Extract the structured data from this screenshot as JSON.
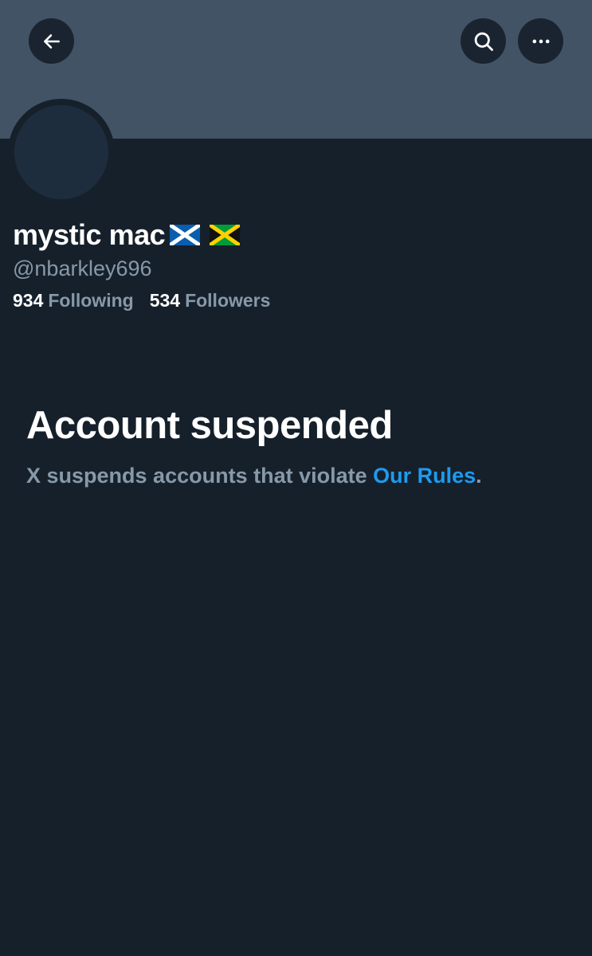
{
  "header": {
    "back_icon": "arrow-left-icon",
    "search_icon": "search-icon",
    "more_icon": "more-horizontal-icon"
  },
  "profile": {
    "display_name": "mystic mac",
    "flags": [
      "scotland-flag",
      "jamaica-flag"
    ],
    "handle": "@nbarkley696",
    "following_count": "934",
    "following_label": "Following",
    "followers_count": "534",
    "followers_label": "Followers"
  },
  "notice": {
    "title": "Account suspended",
    "message": "X suspends accounts that violate ",
    "link_text": "Our Rules",
    "message_end": "."
  },
  "colors": {
    "background": "#16202b",
    "banner": "#425365",
    "link": "#1d9bf0",
    "secondary_text": "#8799a8"
  }
}
